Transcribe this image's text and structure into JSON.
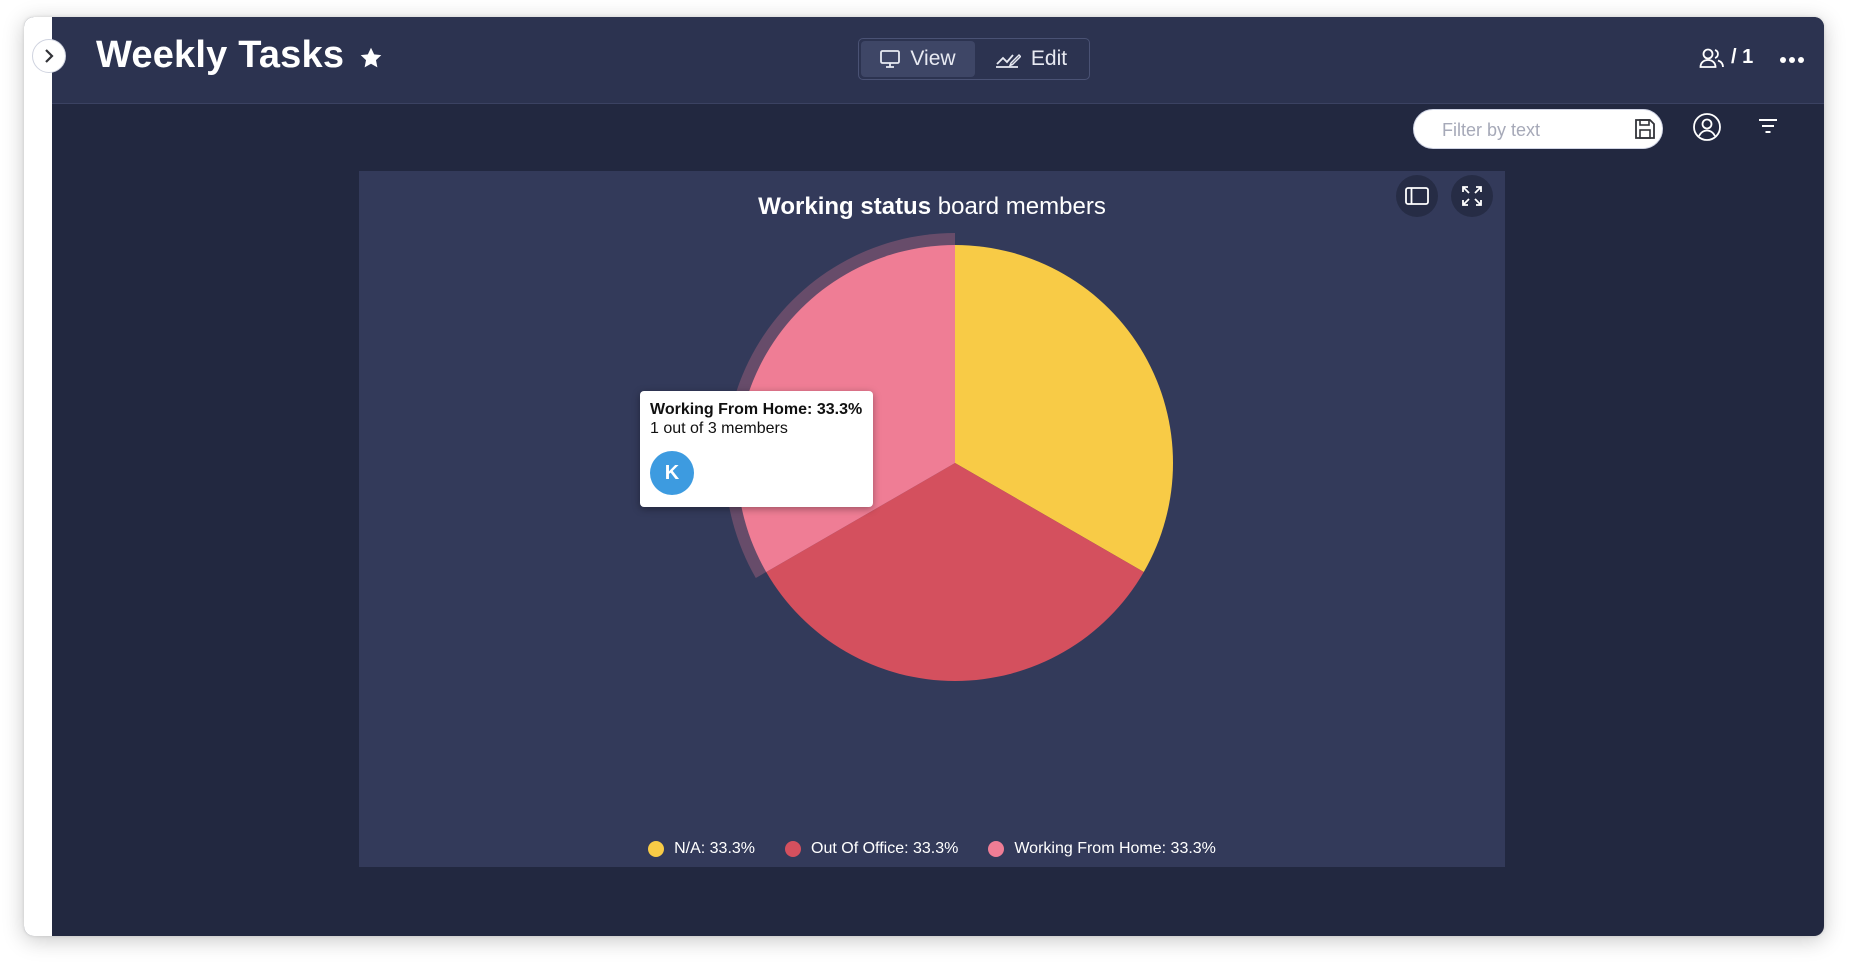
{
  "board": {
    "title": "Weekly Tasks"
  },
  "header": {
    "view_label": "View",
    "edit_label": "Edit",
    "members_count": "/ 1"
  },
  "toolbar": {
    "filter_placeholder": "Filter by text"
  },
  "widget": {
    "title_bold": "Working status",
    "title_rest": "board members"
  },
  "tooltip": {
    "heading": "Working From Home: 33.3%",
    "subtext": "1 out of 3 members",
    "avatar_initial": "K",
    "avatar_color": "#3d9be0"
  },
  "chart_data": {
    "type": "pie",
    "title": "Working status board members",
    "slices": [
      {
        "label": "N/A",
        "value": 33.3,
        "color": "#f8cb46"
      },
      {
        "label": "Out Of Office",
        "value": 33.3,
        "color": "#d4505e"
      },
      {
        "label": "Working From Home",
        "value": 33.3,
        "color": "#ef7d95"
      }
    ],
    "legend": [
      {
        "text": "N/A: 33.3%",
        "color": "#f8cb46"
      },
      {
        "text": "Out Of Office: 33.3%",
        "color": "#d4505e"
      },
      {
        "text": "Working From Home: 33.3%",
        "color": "#ef7d95"
      }
    ],
    "highlighted": "Working From Home",
    "legend_position": "bottom"
  },
  "colors": {
    "app_background": "#222840",
    "header_background": "#2c3350",
    "chart_card": "#333a5a"
  }
}
